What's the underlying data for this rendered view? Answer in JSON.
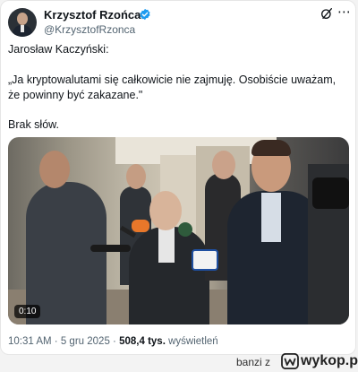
{
  "tweet": {
    "author_name": "Krzysztof Rzońca",
    "author_handle": "@KrzysztofRzonca",
    "text_line1": "Jarosław Kaczyński:",
    "text_quote": "„Ja kryptowalutami się całkowicie nie zajmuję. Osobiście uważam, że powinny być zakazane.\"",
    "text_line3": "Brak słów.",
    "video_duration": "0:10",
    "time": "10:31 AM",
    "date": "5 gru 2025",
    "views_count": "508,4 tys.",
    "views_label": "wyświetleń",
    "separator": "·",
    "more_icon": "⋯"
  },
  "watermark": {
    "user": "banzi",
    "preposition": "z",
    "brand": "wykop.pl"
  },
  "colors": {
    "verified": "#1d9bf0",
    "secondary_text": "#536471",
    "primary_text": "#0f1419"
  }
}
